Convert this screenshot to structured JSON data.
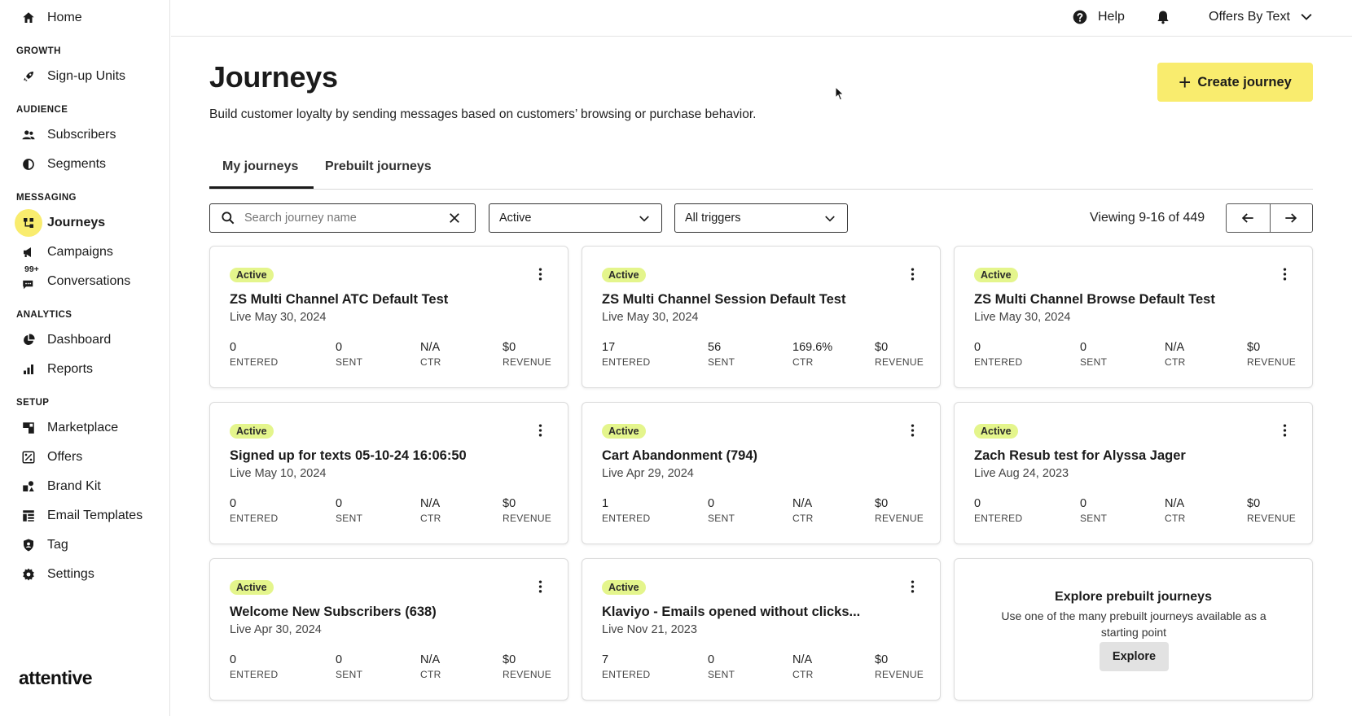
{
  "sidebar": {
    "home": "Home",
    "sections": {
      "growth": "GROWTH",
      "audience": "AUDIENCE",
      "messaging": "MESSAGING",
      "analytics": "ANALYTICS",
      "setup": "SETUP"
    },
    "items": {
      "signup_units": "Sign-up Units",
      "subscribers": "Subscribers",
      "segments": "Segments",
      "journeys": "Journeys",
      "campaigns": "Campaigns",
      "conversations": "Conversations",
      "conversations_badge": "99+",
      "dashboard": "Dashboard",
      "reports": "Reports",
      "marketplace": "Marketplace",
      "offers": "Offers",
      "brand_kit": "Brand Kit",
      "email_templates": "Email Templates",
      "tag": "Tag",
      "settings": "Settings"
    },
    "logo": "attentive"
  },
  "topbar": {
    "help": "Help",
    "account": "Offers By Text"
  },
  "page": {
    "title": "Journeys",
    "subtitle": "Build customer loyalty by sending messages based on customers’ browsing or purchase behavior.",
    "create_button": "Create journey",
    "tabs": [
      "My journeys",
      "Prebuilt journeys"
    ]
  },
  "filters": {
    "search_placeholder": "Search journey name",
    "status": "Active",
    "triggers": "All triggers",
    "viewing": "Viewing 9-16 of 449"
  },
  "stat_labels": [
    "ENTERED",
    "SENT",
    "CTR",
    "REVENUE"
  ],
  "cards": [
    {
      "status": "Active",
      "name": "ZS Multi Channel ATC Default Test",
      "live": "Live May 30, 2024",
      "stats": [
        "0",
        "0",
        "N/A",
        "$0"
      ]
    },
    {
      "status": "Active",
      "name": "ZS Multi Channel Session Default Test",
      "live": "Live May 30, 2024",
      "stats": [
        "17",
        "56",
        "169.6%",
        "$0"
      ]
    },
    {
      "status": "Active",
      "name": "ZS Multi Channel Browse Default Test",
      "live": "Live May 30, 2024",
      "stats": [
        "0",
        "0",
        "N/A",
        "$0"
      ]
    },
    {
      "status": "Active",
      "name": "Signed up for texts 05-10-24 16:06:50",
      "live": "Live May 10, 2024",
      "stats": [
        "0",
        "0",
        "N/A",
        "$0"
      ]
    },
    {
      "status": "Active",
      "name": "Cart Abandonment (794)",
      "live": "Live Apr 29, 2024",
      "stats": [
        "1",
        "0",
        "N/A",
        "$0"
      ]
    },
    {
      "status": "Active",
      "name": "Zach Resub test for Alyssa Jager",
      "live": "Live Aug 24, 2023",
      "stats": [
        "0",
        "0",
        "N/A",
        "$0"
      ]
    },
    {
      "status": "Active",
      "name": "Welcome New Subscribers (638)",
      "live": "Live Apr 30, 2024",
      "stats": [
        "0",
        "0",
        "N/A",
        "$0"
      ]
    },
    {
      "status": "Active",
      "name": "Klaviyo - Emails opened without clicks...",
      "live": "Live Nov 21, 2023",
      "stats": [
        "7",
        "0",
        "N/A",
        "$0"
      ]
    }
  ],
  "explore": {
    "title": "Explore prebuilt journeys",
    "desc": "Use one of the many prebuilt journeys available as a starting point",
    "button": "Explore"
  },
  "colors": {
    "accent": "#f9ec6e",
    "status_badge": "#e4f58c"
  }
}
